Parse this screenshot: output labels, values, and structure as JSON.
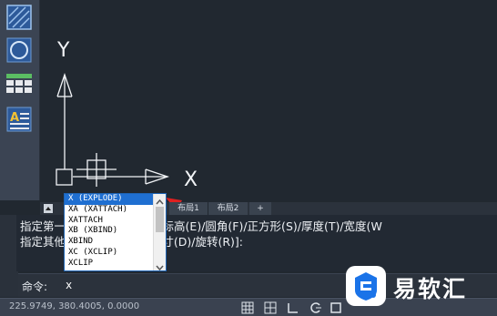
{
  "palette": {
    "tools": [
      {
        "icon": "hatch-icon"
      },
      {
        "icon": "circle-icon"
      },
      {
        "icon": "table-icon"
      },
      {
        "icon": "text-style-icon"
      }
    ]
  },
  "canvas": {
    "y_axis_label": "Y",
    "x_axis_label": "X"
  },
  "tabs": {
    "layout1": "布局1",
    "layout2": "布局2",
    "add": "+"
  },
  "autocomplete": {
    "items": [
      "X (EXPLODE)",
      "XA (XATTACH)",
      "XATTACH",
      "XB (XBIND)",
      "XBIND",
      "XC (XCLIP)",
      "XCLIP"
    ],
    "selected_index": 0
  },
  "history": {
    "line1": "指定第一个角点或 [倒角(C)/标高(E)/圆角(F)/正方形(S)/厚度(T)/宽度(W",
    "line2": "指定其他角点或 [面积(A)/尺寸(D)/旋转(R)]:"
  },
  "command": {
    "prompt": "命令:",
    "text": "x"
  },
  "status": {
    "coordinates": "225.9749, 380.4005, 0.0000"
  },
  "watermark": {
    "text": "易软汇"
  },
  "colors": {
    "canvas_bg": "#212830",
    "selection": "#1f6fd1",
    "arrow": "#e02020",
    "logo_accent": "#1a73e8"
  }
}
